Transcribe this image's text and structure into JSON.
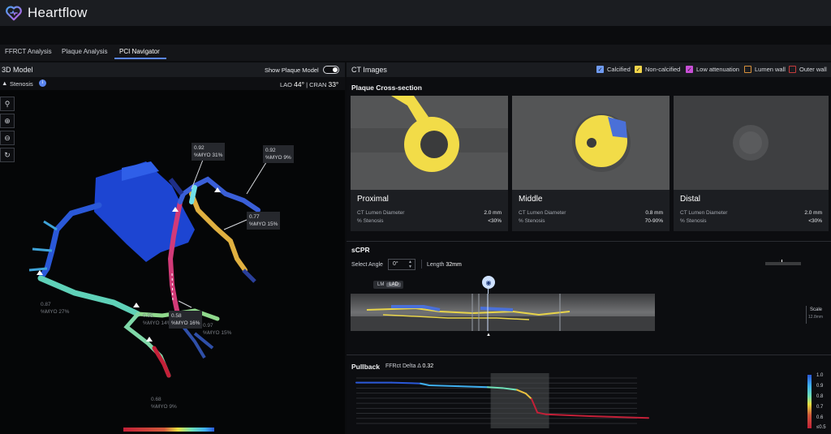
{
  "app": {
    "name": "Heartflow"
  },
  "tabs": [
    {
      "label": "FFRCT Analysis"
    },
    {
      "label": "Plaque Analysis"
    },
    {
      "label": "PCI Navigator",
      "active": true
    }
  ],
  "model3d": {
    "title": "3D Model",
    "show_plaque_label": "Show Plaque Model",
    "show_plaque_on": false,
    "stenosis_label": "Stenosis",
    "lao_label": "LAO",
    "lao_value": "44°",
    "cran_label": "CRAN",
    "cran_value": "33°",
    "separator": "|",
    "labels": [
      {
        "value": "0.92",
        "myo": "%MYO 31%"
      },
      {
        "value": "0.92",
        "myo": "%MYO 9%"
      },
      {
        "value": "0.77",
        "myo": "%MYO 15%"
      },
      {
        "value": "0.87",
        "myo": "%MYO 27%"
      },
      {
        "value": "0.95",
        "myo": "%MYO 14%"
      },
      {
        "value": "0.58",
        "myo": "%MYO 16%"
      },
      {
        "value": "0.97",
        "myo": "%MYO 15%"
      },
      {
        "value": "0.68",
        "myo": "%MYO 9%"
      }
    ]
  },
  "ct": {
    "title": "CT Images",
    "legend": [
      {
        "label": "Calcified",
        "checked": true,
        "color": "#6f9bf2"
      },
      {
        "label": "Non-calcified",
        "checked": true,
        "color": "#f1d44a"
      },
      {
        "label": "Low attenuation",
        "checked": true,
        "color": "#c84fd6"
      },
      {
        "label": "Lumen wall",
        "checked": false,
        "color": "#d7903a"
      },
      {
        "label": "Outer wall",
        "checked": false,
        "color": "#c43b3b"
      }
    ],
    "cross_section_title": "Plaque Cross-section",
    "lumen_label": "CT Lumen Diameter",
    "stenosis_label": "% Stenosis",
    "cards": [
      {
        "name": "Proximal",
        "diameter": "2.0 mm",
        "stenosis": "<30%"
      },
      {
        "name": "Middle",
        "diameter": "0.8 mm",
        "stenosis": "70-90%"
      },
      {
        "name": "Distal",
        "diameter": "2.0 mm",
        "stenosis": "<30%"
      }
    ]
  },
  "scpr": {
    "title": "sCPR",
    "select_angle_label": "Select Angle",
    "angle_value": "0°",
    "length_label": "Length",
    "length_value": "32mm",
    "tag_lm": "LM",
    "tag_lad": "LAD",
    "scale_label": "Scale",
    "scale_value": "12.8mm"
  },
  "pullback": {
    "title": "Pullback",
    "delta_label": "FFRct Delta Δ",
    "delta_value": "0.32",
    "scale_ticks": [
      "1.0",
      "0.9",
      "0.8",
      "0.7",
      "0.6",
      "≤0.5"
    ]
  },
  "chart_data": {
    "type": "line",
    "title": "Pullback",
    "ylim": [
      0.5,
      1.0
    ],
    "series": [
      {
        "x": [
          0,
          12,
          22,
          25,
          35,
          45,
          50,
          55,
          58,
          60,
          62,
          65,
          80,
          100
        ],
        "y": [
          0.95,
          0.95,
          0.94,
          0.92,
          0.91,
          0.9,
          0.89,
          0.87,
          0.83,
          0.77,
          0.62,
          0.6,
          0.58,
          0.56
        ]
      }
    ],
    "highlight_range": [
      46,
      66
    ]
  }
}
